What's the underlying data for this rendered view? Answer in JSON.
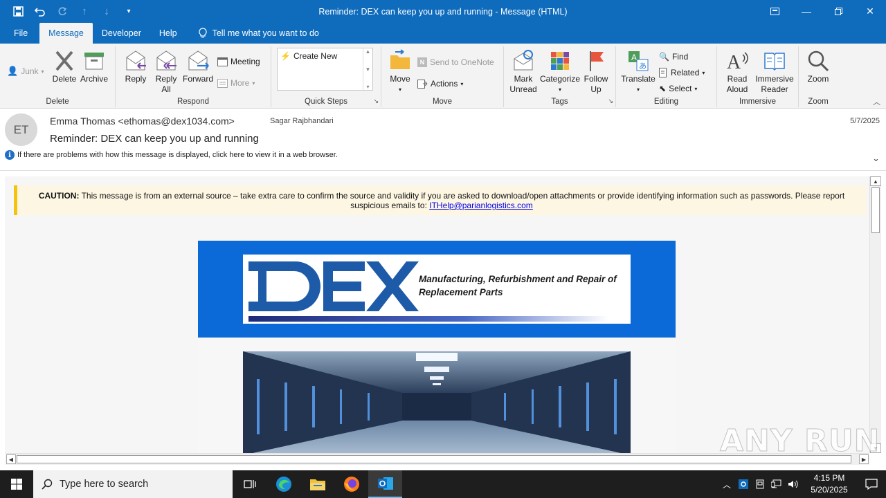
{
  "window": {
    "title": "Reminder: DEX can keep you up and running  -  Message (HTML)"
  },
  "menu": {
    "file": "File",
    "message": "Message",
    "developer": "Developer",
    "help": "Help",
    "tell_me": "Tell me what you want to do"
  },
  "ribbon": {
    "junk": "Junk",
    "delete": "Delete",
    "archive": "Archive",
    "group_delete": "Delete",
    "reply": "Reply",
    "reply_all_1": "Reply",
    "reply_all_2": "All",
    "forward": "Forward",
    "meeting": "Meeting",
    "more": "More",
    "group_respond": "Respond",
    "create_new": "Create New",
    "group_quick_steps": "Quick Steps",
    "move": "Move",
    "send_onenote": "Send to OneNote",
    "actions": "Actions",
    "group_move": "Move",
    "mark_unread_1": "Mark",
    "mark_unread_2": "Unread",
    "categorize": "Categorize",
    "follow_up_1": "Follow",
    "follow_up_2": "Up",
    "group_tags": "Tags",
    "translate": "Translate",
    "find": "Find",
    "related": "Related",
    "select": "Select",
    "group_editing": "Editing",
    "read_aloud_1": "Read",
    "read_aloud_2": "Aloud",
    "immersive_1": "Immersive",
    "immersive_2": "Reader",
    "group_immersive": "Immersive",
    "zoom": "Zoom",
    "group_zoom": "Zoom"
  },
  "message": {
    "avatar_initials": "ET",
    "from": "Emma Thomas <ethomas@dex1034.com>",
    "to": "Sagar Rajbhandari",
    "date": "5/7/2025",
    "subject": "Reminder: DEX can keep you up and running",
    "info_bar": "If there are problems with how this message is displayed, click here to view it in a web browser."
  },
  "body": {
    "caution_label": "CAUTION:",
    "caution_text": " This message is from an external source – take extra care to confirm the source and validity if you are asked to download/open attachments or provide identifying information such as passwords. Please report suspicious emails to: ",
    "caution_email": "ITHelp@parianlogistics.com",
    "logo_text": "DEX",
    "logo_tagline": "Manufacturing, Refurbishment and Repair of Replacement Parts"
  },
  "watermark": "ANY RUN",
  "taskbar": {
    "search_placeholder": "Type here to search",
    "time": "4:15 PM",
    "date": "5/20/2025"
  },
  "colors": {
    "titlebar": "#0f6cbd",
    "ribbon": "#f3f3f3",
    "banner": "#0b6ad8",
    "caution_bar": "#f5c211"
  }
}
